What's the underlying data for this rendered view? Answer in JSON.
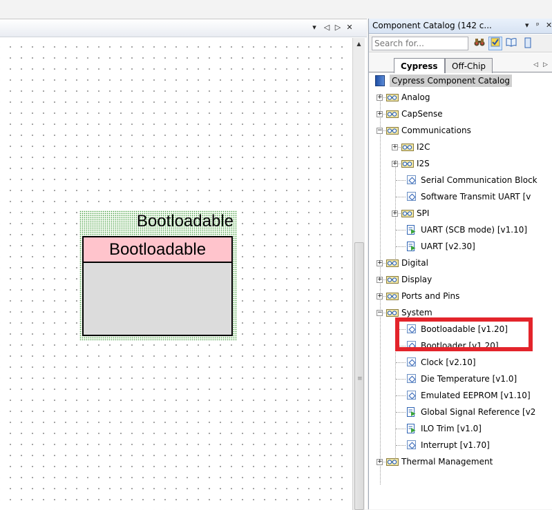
{
  "schematic": {
    "title_buttons": [
      "▾",
      "◁",
      "▷",
      "✕"
    ],
    "symbol": {
      "instance_name": "Bootloadable",
      "component_title": "Bootloadable"
    },
    "scroll_grip": "≡"
  },
  "catalog": {
    "title": "Component Catalog (142 c...",
    "title_buttons": [
      "▾",
      "ᵖ",
      "✕"
    ],
    "search": {
      "placeholder": "Search for..."
    },
    "tabs": [
      {
        "label": "Cypress",
        "active": true
      },
      {
        "label": "Off-Chip",
        "active": false
      }
    ],
    "tab_scroll": [
      "◁",
      "▷"
    ],
    "root": "Cypress Component Catalog",
    "tree": [
      {
        "label": "Analog",
        "type": "category",
        "expander": "+"
      },
      {
        "label": "CapSense",
        "type": "category",
        "expander": "+"
      },
      {
        "label": "Communications",
        "type": "category",
        "expander": "−"
      },
      {
        "label": "I2C",
        "type": "category",
        "expander": "+"
      },
      {
        "label": "I2S",
        "type": "category",
        "expander": "+"
      },
      {
        "label": "Serial Communication Block",
        "type": "component"
      },
      {
        "label": "Software Transmit UART [v",
        "type": "component"
      },
      {
        "label": "SPI",
        "type": "category",
        "expander": "+"
      },
      {
        "label": "UART (SCB mode) [v1.10]",
        "type": "schematic"
      },
      {
        "label": "UART [v2.30]",
        "type": "schematic"
      },
      {
        "label": "Digital",
        "type": "category",
        "expander": "+"
      },
      {
        "label": "Display",
        "type": "category",
        "expander": "+"
      },
      {
        "label": "Ports and Pins",
        "type": "category",
        "expander": "+"
      },
      {
        "label": "System",
        "type": "category",
        "expander": "−"
      },
      {
        "label": "Bootloadable [v1.20]",
        "type": "component"
      },
      {
        "label": "Bootloader [v1.20]",
        "type": "component"
      },
      {
        "label": "Clock [v2.10]",
        "type": "component"
      },
      {
        "label": "Die Temperature [v1.0]",
        "type": "component"
      },
      {
        "label": "Emulated EEPROM [v1.10]",
        "type": "component"
      },
      {
        "label": "Global Signal Reference [v2",
        "type": "schematic"
      },
      {
        "label": "ILO Trim [v1.0]",
        "type": "schematic"
      },
      {
        "label": "Interrupt [v1.70]",
        "type": "component"
      },
      {
        "label": "Thermal Management",
        "type": "category",
        "expander": "+"
      }
    ]
  },
  "colors": {
    "highlight": "#e3242b",
    "symbol_header": "#ffc4cc",
    "symbol_body": "#dcdcdc"
  }
}
